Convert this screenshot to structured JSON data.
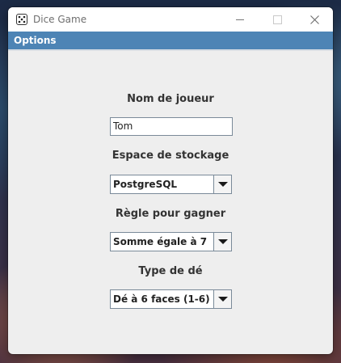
{
  "window": {
    "title": "Dice Game",
    "app_icon": "dice-icon",
    "controls": {
      "minimize": "minimize-icon",
      "maximize": "maximize-icon",
      "close": "close-icon"
    }
  },
  "menubar": {
    "items": [
      {
        "label": "Options"
      }
    ]
  },
  "form": {
    "player_name": {
      "label": "Nom de joueur",
      "value": "Tom"
    },
    "storage": {
      "label": "Espace de stockage",
      "selected": "PostgreSQL"
    },
    "win_rule": {
      "label": "Règle pour gagner",
      "selected": "Somme égale à 7"
    },
    "die_type": {
      "label": "Type de dé",
      "selected": "Dé à 6 faces (1-6)"
    }
  },
  "colors": {
    "menubar_bg": "#4d84b5",
    "window_bg": "#eeeeee",
    "field_border": "#7a8a99"
  }
}
